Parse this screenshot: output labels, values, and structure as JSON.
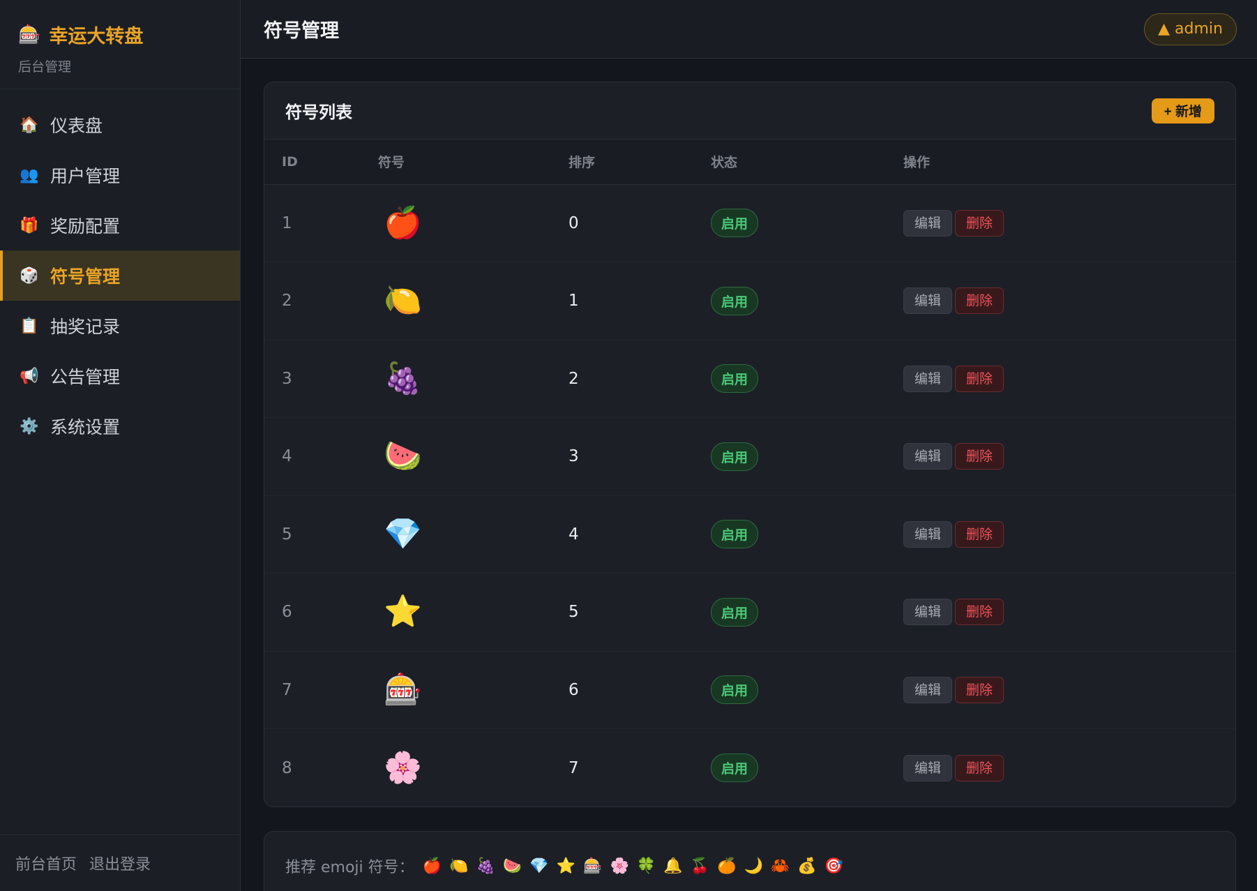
{
  "brand": {
    "icon": "🎰",
    "title": "幸运大转盘",
    "subtitle": "后台管理"
  },
  "nav": [
    {
      "icon": "🏠",
      "label": "仪表盘",
      "icon_name": "home-icon"
    },
    {
      "icon": "👥",
      "label": "用户管理",
      "icon_name": "users-icon"
    },
    {
      "icon": "🎁",
      "label": "奖励配置",
      "icon_name": "gift-icon"
    },
    {
      "icon": "🎲",
      "label": "符号管理",
      "icon_name": "dice-icon",
      "active": true
    },
    {
      "icon": "📋",
      "label": "抽奖记录",
      "icon_name": "clipboard-icon"
    },
    {
      "icon": "📢",
      "label": "公告管理",
      "icon_name": "megaphone-icon"
    },
    {
      "icon": "⚙️",
      "label": "系统设置",
      "icon_name": "gear-icon"
    }
  ],
  "footer": {
    "home": "前台首页",
    "logout": "退出登录"
  },
  "header": {
    "title": "符号管理",
    "user": "▲ admin"
  },
  "card": {
    "title": "符号列表",
    "add_label": "+ 新增"
  },
  "table": {
    "columns": [
      "ID",
      "符号",
      "排序",
      "状态",
      "操作"
    ],
    "rows": [
      {
        "id": "1",
        "symbol": "🍎",
        "sort": "0",
        "status": "启用"
      },
      {
        "id": "2",
        "symbol": "🍋",
        "sort": "1",
        "status": "启用"
      },
      {
        "id": "3",
        "symbol": "🍇",
        "sort": "2",
        "status": "启用"
      },
      {
        "id": "4",
        "symbol": "🍉",
        "sort": "3",
        "status": "启用"
      },
      {
        "id": "5",
        "symbol": "💎",
        "sort": "4",
        "status": "启用"
      },
      {
        "id": "6",
        "symbol": "⭐",
        "sort": "5",
        "status": "启用"
      },
      {
        "id": "7",
        "symbol": "🎰",
        "sort": "6",
        "status": "启用"
      },
      {
        "id": "8",
        "symbol": "🌸",
        "sort": "7",
        "status": "启用"
      }
    ],
    "edit_label": "编辑",
    "delete_label": "删除"
  },
  "recommend": {
    "label": "推荐 emoji 符号：",
    "emojis": [
      "🍎",
      "🍋",
      "🍇",
      "🍉",
      "💎",
      "⭐",
      "🎰",
      "🌸",
      "🍀",
      "🔔",
      "🍒",
      "🍊",
      "🌙",
      "🦀",
      "💰",
      "🎯"
    ]
  },
  "colors": {
    "accent": "#eaa426",
    "success": "#4cc777",
    "danger": "#f0535b",
    "background": "#13161d"
  }
}
